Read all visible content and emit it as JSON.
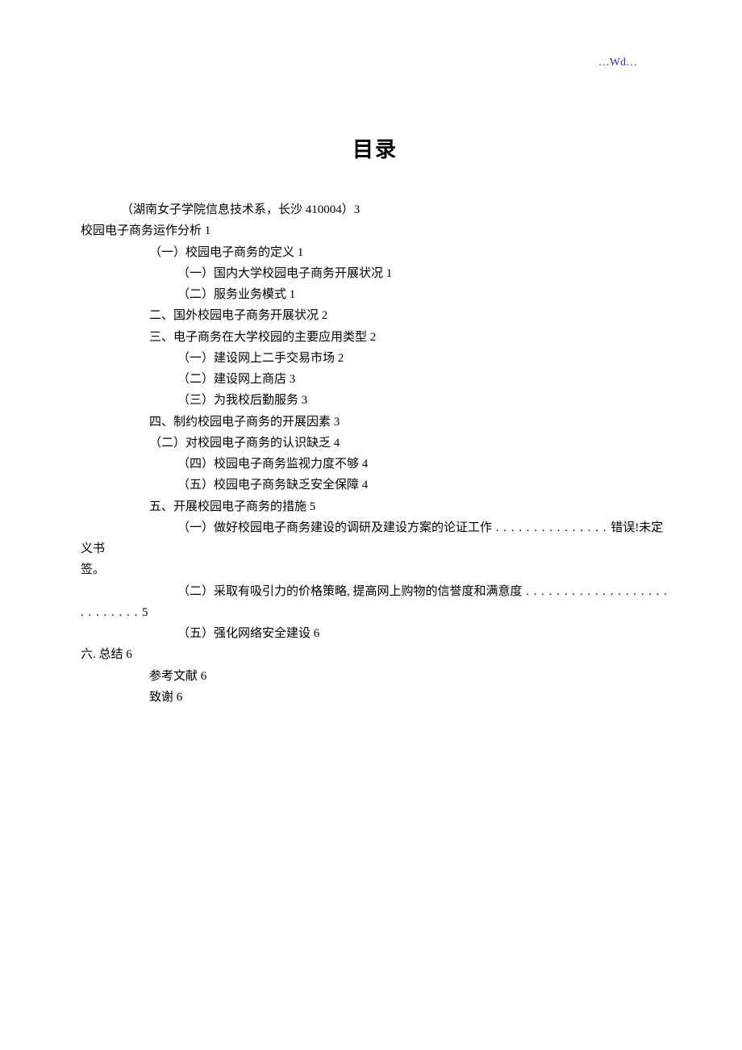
{
  "header": {
    "mark": "…Wd…"
  },
  "title": "目录",
  "toc": {
    "line1": "（湖南女子学院信息技术系，长沙 410004）3",
    "line2": "校园电子商务运作分析 1",
    "line3": "（一）校园电子商务的定义 1",
    "line4": "（一）国内大学校园电子商务开展状况 1",
    "line5": "（二）服务业务模式 1",
    "line6": "二、国外校园电子商务开展状况 2",
    "line7": "三、电子商务在大学校园的主要应用类型 2",
    "line8": "（一）建设网上二手交易市场 2",
    "line9": "（二）建设网上商店 3",
    "line10": "（三）为我校后勤服务 3",
    "line11": "四、制约校园电子商务的开展因素 3",
    "line12": "（二）对校园电子商务的认识缺乏 4",
    "line13": "（四）校园电子商务监视力度不够 4",
    "line14": "（五）校园电子商务缺乏安全保障 4",
    "line15": "五、开展校园电子商务的措施 5",
    "line16a": "（一）做好校园电子商务建设的调研及建设方案的论证工作",
    "line16dots": " . . . . . . . . . . . . . . . ",
    "line16b": "错误!未定义书",
    "line16c": "签。",
    "line17a": "（二）采取有吸引力的价格策略, 提高网上购物的信誉度和满意度",
    "line17dots": " . . . . . . . . . . . . . . . . . . . . . . . . . . . ",
    "line17b": "5",
    "line18": "（五）强化网络安全建设 6",
    "line19": "六. 总结 6",
    "line20": "参考文献 6",
    "line21": "致谢 6"
  }
}
